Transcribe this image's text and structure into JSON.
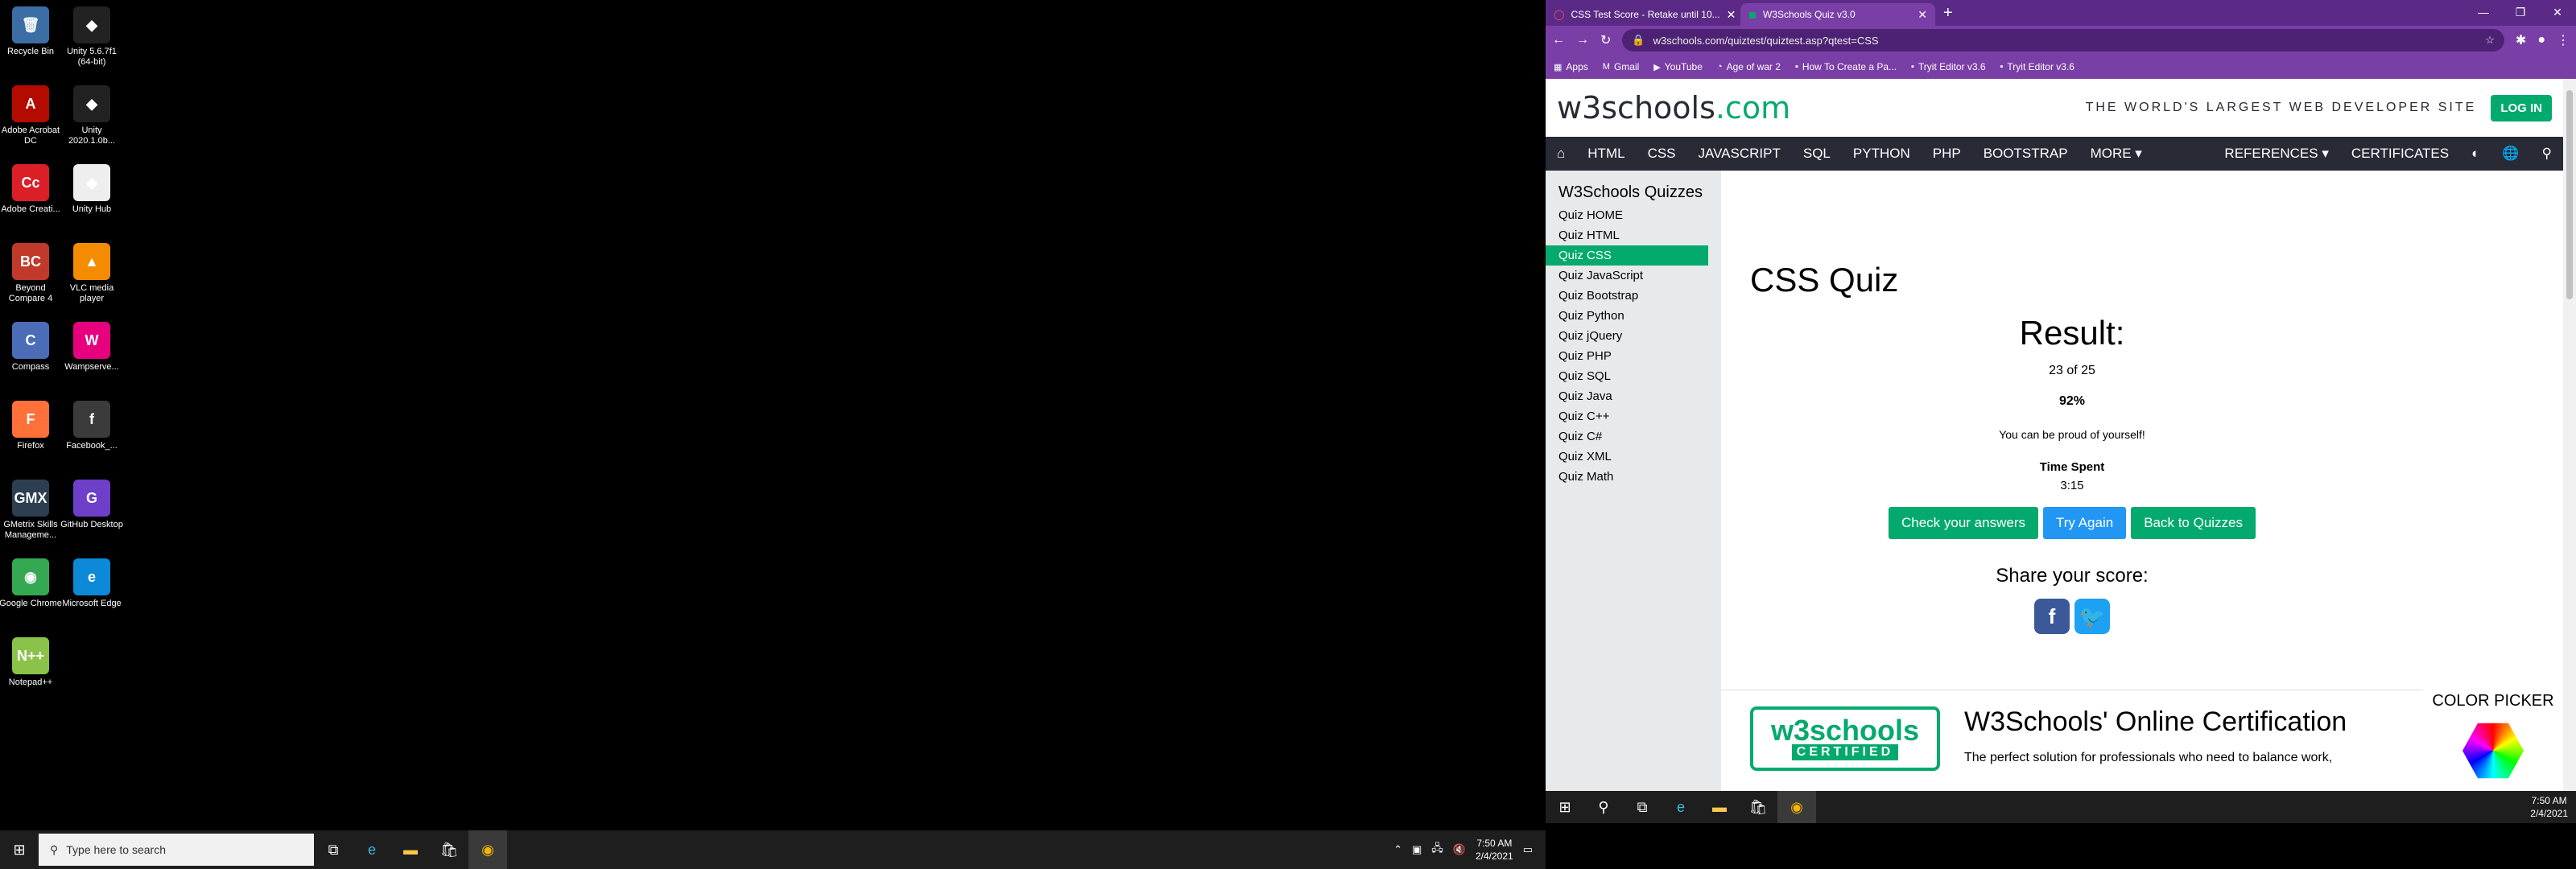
{
  "desktop": {
    "icons": [
      {
        "label": "Recycle Bin",
        "glyph": "🗑",
        "color": "#3b6ea5"
      },
      {
        "label": "Unity 5.6.7f1 (64-bit)",
        "glyph": "◆",
        "color": "#222222"
      },
      {
        "label": "Adobe Acrobat DC",
        "glyph": "A",
        "color": "#b30b00"
      },
      {
        "label": "Unity 2020.1.0b...",
        "glyph": "◆",
        "color": "#222222"
      },
      {
        "label": "Adobe Creati...",
        "glyph": "Cc",
        "color": "#da1f26"
      },
      {
        "label": "Unity Hub",
        "glyph": "◆",
        "color": "#eeeeee"
      },
      {
        "label": "Beyond Compare 4",
        "glyph": "BC",
        "color": "#c0392b"
      },
      {
        "label": "VLC media player",
        "glyph": "▲",
        "color": "#f48b00"
      },
      {
        "label": "Compass",
        "glyph": "C",
        "color": "#4b6cb7"
      },
      {
        "label": "Wampserve...",
        "glyph": "W",
        "color": "#e6007e"
      },
      {
        "label": "Firefox",
        "glyph": "F",
        "color": "#ff7139"
      },
      {
        "label": "Facebook_...",
        "glyph": "f",
        "color": "#3b3b3b"
      },
      {
        "label": "GMetrix Skills Manageme...",
        "glyph": "GMX",
        "color": "#2c3e50"
      },
      {
        "label": "GitHub Desktop",
        "glyph": "G",
        "color": "#6e40c9"
      },
      {
        "label": "Google Chrome",
        "glyph": "◉",
        "color": "#34a853"
      },
      {
        "label": "Microsoft Edge",
        "glyph": "e",
        "color": "#0c8ad8"
      },
      {
        "label": "Notepad++",
        "glyph": "N++",
        "color": "#8bc34a"
      }
    ]
  },
  "taskbar_left": {
    "search_placeholder": "Type here to search",
    "time": "7:50 AM",
    "date": "2/4/2021"
  },
  "browser": {
    "tabs": [
      {
        "title": "CSS Test Score - Retake until 10..."
      },
      {
        "title": "W3Schools Quiz v3.0"
      }
    ],
    "url": "w3schools.com/quiztest/quiztest.asp?qtest=CSS",
    "bookmarks": [
      "Apps",
      "Gmail",
      "YouTube",
      "Age of war 2",
      "How To Create a Pa...",
      "Tryit Editor v3.6",
      "Tryit Editor v3.6"
    ]
  },
  "w3": {
    "logo_main": "w3schools",
    "logo_tld": ".com",
    "tagline": "THE WORLD'S LARGEST WEB DEVELOPER SITE",
    "login": "LOG IN",
    "nav": [
      "HTML",
      "CSS",
      "JAVASCRIPT",
      "SQL",
      "PYTHON",
      "PHP",
      "BOOTSTRAP",
      "MORE ▾"
    ],
    "nav_right": [
      "REFERENCES ▾",
      "CERTIFICATES"
    ],
    "sidebar_title": "W3Schools Quizzes",
    "sidebar": [
      "Quiz HOME",
      "Quiz HTML",
      "Quiz CSS",
      "Quiz JavaScript",
      "Quiz Bootstrap",
      "Quiz Python",
      "Quiz jQuery",
      "Quiz PHP",
      "Quiz SQL",
      "Quiz Java",
      "Quiz C++",
      "Quiz C#",
      "Quiz XML",
      "Quiz Math"
    ],
    "sidebar_active": "Quiz CSS",
    "quiz_title": "CSS Quiz",
    "result_title": "Result:",
    "score": "23 of 25",
    "percent": "92%",
    "message": "You can be proud of yourself!",
    "time_label": "Time Spent",
    "time_value": "3:15",
    "btn_check": "Check your answers",
    "btn_try": "Try Again",
    "btn_back": "Back to Quizzes",
    "share": "Share your score:",
    "cert_logo": "w3schools",
    "cert_logo_sub": "CERTIFIED",
    "cert_title": "W3Schools' Online Certification",
    "cert_text": "The perfect solution for professionals who need to balance work,",
    "color_picker": "COLOR PICKER"
  },
  "taskbar_right": {
    "time": "7:50 AM",
    "date": "2/4/2021"
  },
  "colors": {
    "w3_green": "#04aa6d",
    "w3_dark": "#282a35",
    "chrome_purple": "#7a3fa6",
    "fb": "#3b5998",
    "tw": "#1da1f2"
  }
}
